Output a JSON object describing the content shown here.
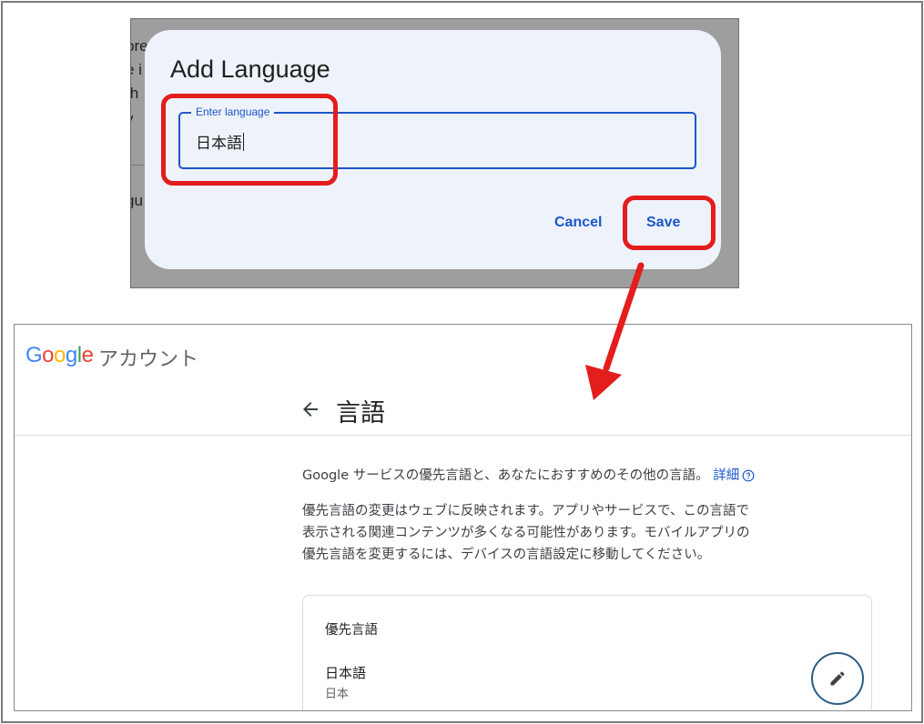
{
  "dialog_screenshot": {
    "background_fragments": [
      "pre",
      "e i",
      "th",
      "y",
      "gu"
    ],
    "dialog": {
      "title": "Add Language",
      "field_label": "Enter language",
      "field_value": "日本語",
      "cancel_label": "Cancel",
      "save_label": "Save"
    }
  },
  "account_screenshot": {
    "logo": {
      "letters": [
        "G",
        "o",
        "o",
        "g",
        "l",
        "e"
      ]
    },
    "account_label": "アカウント",
    "page_title": "言語",
    "intro_text": "Google サービスの優先言語と、あなたにおすすめのその他の言語。",
    "details_link": "詳細",
    "description": [
      "優先言語の変更はウェブに反映されます。アプリやサービスで、この言語で",
      "表示される関連コンテンツが多くなる可能性があります。モバイルアプリの",
      "優先言語を変更するには、デバイスの言語設定に移動してください。"
    ],
    "preferred_card": {
      "title": "優先言語",
      "language": "日本語",
      "language_sub": "日本"
    }
  },
  "colors": {
    "highlight": "#e41d1d",
    "accent_blue": "#1a57c8",
    "dialog_bg": "#eef2fb"
  },
  "icons": {
    "back": "arrow-left-icon",
    "help": "help-circle-icon",
    "edit": "pencil-icon"
  }
}
